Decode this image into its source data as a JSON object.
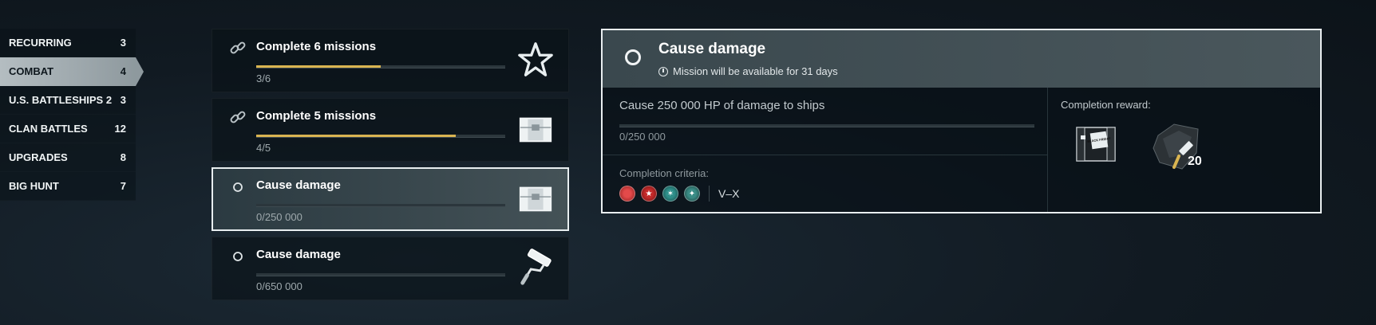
{
  "sidebar": {
    "items": [
      {
        "label": "RECURRING",
        "count": "3"
      },
      {
        "label": "COMBAT",
        "count": "4",
        "active": true
      },
      {
        "label": "U.S. BATTLESHIPS 2",
        "count": "3"
      },
      {
        "label": "CLAN BATTLES",
        "count": "12"
      },
      {
        "label": "UPGRADES",
        "count": "8"
      },
      {
        "label": "BIG HUNT",
        "count": "7"
      }
    ]
  },
  "missions": [
    {
      "title": "Complete 6 missions",
      "progress_text": "3/6",
      "progress": 0.5,
      "icon": "chain-link-icon",
      "reward_icon": "star-icon"
    },
    {
      "title": "Complete 5 missions",
      "progress_text": "4/5",
      "progress": 0.8,
      "icon": "chain-link-icon",
      "reward_icon": "container-icon"
    },
    {
      "title": "Cause damage",
      "progress_text": "0/250 000",
      "progress": 0,
      "icon": "radio-circle-icon",
      "reward_icon": "container-icon",
      "selected": true
    },
    {
      "title": "Cause damage",
      "progress_text": "0/650 000",
      "progress": 0,
      "icon": "radio-circle-icon",
      "reward_icon": "paint-roller-icon"
    }
  ],
  "detail": {
    "title": "Cause damage",
    "availability": "Mission will be available for 31 days",
    "task": "Cause 250 000 HP of damage to ships",
    "progress_text": "0/250 000",
    "criteria_label": "Completion criteria:",
    "nations": [
      "japan-flag-icon",
      "ussr-flag-icon",
      "pan-asia-flag-icon",
      "commonwealth-flag-icon"
    ],
    "tier": "V–X",
    "reward_label": "Completion reward:",
    "rewards": [
      {
        "icon": "black-friday-container-icon",
        "container_text": "BLACK FRIDAY"
      },
      {
        "icon": "camouflage-icon",
        "quantity": "20"
      }
    ]
  },
  "colors": {
    "accent": "#d9b451",
    "selected_border": "#e9eef0",
    "active_tab": "#a5afb4"
  }
}
